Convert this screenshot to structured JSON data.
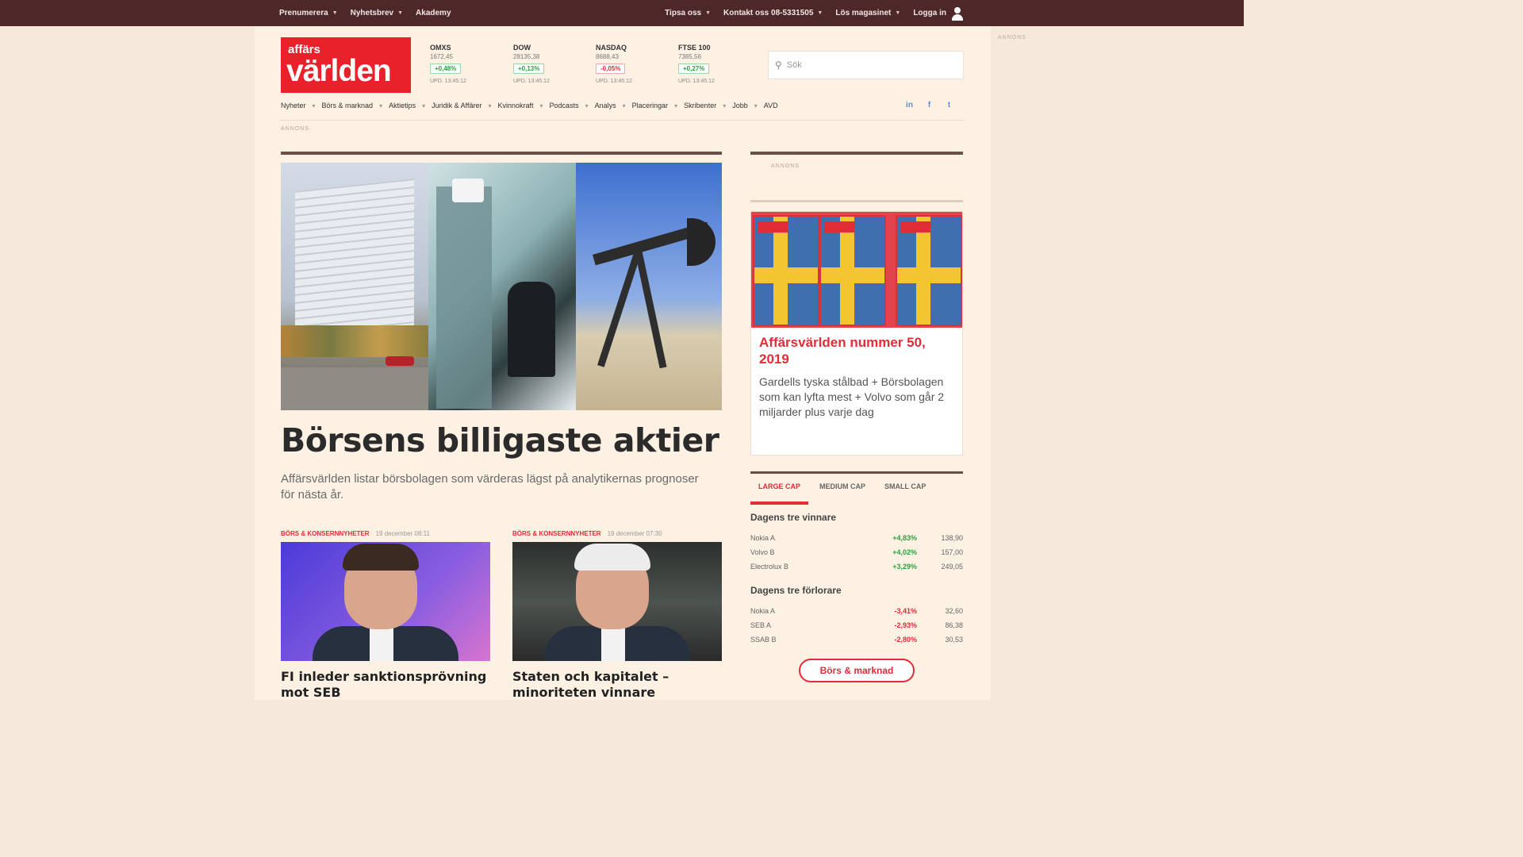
{
  "topbar": {
    "left": [
      "Prenumerera",
      "Nyhetsbrev",
      "Akademy"
    ],
    "right": [
      "Tipsa oss",
      "Kontakt oss 08-5331505",
      "Lös magasinet",
      "Logga in"
    ]
  },
  "logo": {
    "small": "affärs",
    "big": "världen"
  },
  "tickers": [
    {
      "name": "OMXS",
      "value": "1672,45",
      "change": "+0,48%",
      "direction": "up",
      "updated": "UPD. 13:45:12"
    },
    {
      "name": "DOW",
      "value": "28135,38",
      "change": "+0,13%",
      "direction": "up",
      "updated": "UPD. 13:45:12"
    },
    {
      "name": "NASDAQ",
      "value": "8688,43",
      "change": "-0,05%",
      "direction": "down",
      "updated": "UPD. 13:45:12"
    },
    {
      "name": "FTSE 100",
      "value": "7385,56",
      "change": "+0,27%",
      "direction": "up",
      "updated": "UPD. 13:45:12"
    }
  ],
  "search": {
    "placeholder": "Sök"
  },
  "nav": [
    "Nyheter",
    "Börs & marknad",
    "Aktietips",
    "Juridik & Affärer",
    "Kvinnokraft",
    "Podcasts",
    "Analys",
    "Placeringar",
    "Skribenter",
    "Jobb",
    "AVD"
  ],
  "colors": {
    "brand_red": "#e22c38",
    "topbar": "#4e2828",
    "page_bg": "#fdf1e4"
  },
  "main": {
    "headline": "Börsens billigaste aktier",
    "lead": "Affärsvärlden listar börsbolagen som värderas lägst på analytikernas prognoser för nästa år."
  },
  "cards": [
    {
      "category": "BÖRS & KONSERNNYHETER",
      "date": "19 december 08:11",
      "title": "FI inleder sanktionsprövning mot SEB"
    },
    {
      "category": "BÖRS & KONSERNNYHETER",
      "date": "19 december 07:30",
      "title": "Staten och kapitalet – minoriteten vinnare"
    }
  ],
  "promo": {
    "title": "Affärsvärlden nummer 50, 2019",
    "text": "Gardells tyska stålbad + Börsbolagen som kan lyfta mest + Volvo som går 2 miljarder plus varje dag"
  },
  "market": {
    "tabs": [
      "LARGE CAP",
      "MEDIUM CAP",
      "SMALL CAP"
    ],
    "winners_heading": "Dagens tre vinnare",
    "winners": [
      {
        "name": "Nokia A",
        "change": "+4,83%",
        "price": "138,90"
      },
      {
        "name": "Volvo B",
        "change": "+4,02%",
        "price": "157,00"
      },
      {
        "name": "Electrolux B",
        "change": "+3,29%",
        "price": "249,05"
      }
    ],
    "losers_heading": "Dagens tre förlorare",
    "losers": [
      {
        "name": "Nokia A",
        "change": "-3,41%",
        "price": "32,60"
      },
      {
        "name": "SEB A",
        "change": "-2,93%",
        "price": "86,38"
      },
      {
        "name": "SSAB B",
        "change": "-2,80%",
        "price": "30,53"
      }
    ],
    "button": "Börs & marknad"
  }
}
